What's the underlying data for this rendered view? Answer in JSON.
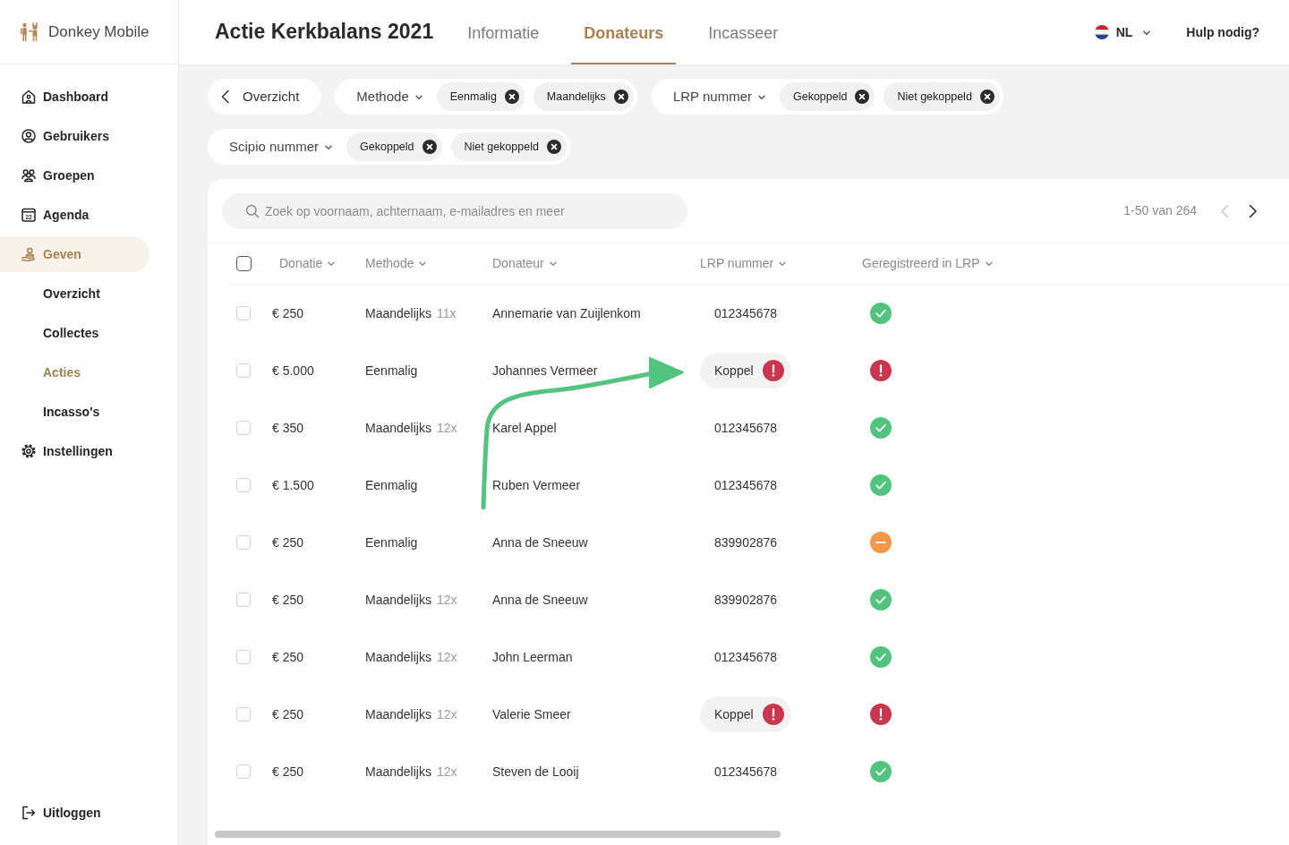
{
  "sidebar": {
    "brand": "Donkey Mobile",
    "items": [
      {
        "label": "Dashboard",
        "selected": false
      },
      {
        "label": "Gebruikers",
        "selected": false
      },
      {
        "label": "Groepen",
        "selected": false
      },
      {
        "label": "Agenda",
        "selected": false,
        "icon_text": "22"
      },
      {
        "label": "Geven",
        "selected": true,
        "children": [
          {
            "label": "Overzicht",
            "selected": false
          },
          {
            "label": "Collectes",
            "selected": false
          },
          {
            "label": "Acties",
            "selected": true
          },
          {
            "label": "Incasso's",
            "selected": false
          }
        ]
      },
      {
        "label": "Instellingen",
        "selected": false
      }
    ],
    "logout": "Uitloggen"
  },
  "header": {
    "title": "Actie Kerkbalans 2021",
    "tabs": [
      {
        "label": "Informatie",
        "selected": false
      },
      {
        "label": "Donateurs",
        "selected": true
      },
      {
        "label": "Incasseer",
        "selected": false
      }
    ],
    "language": "NL",
    "help": "Hulp nodig?"
  },
  "filters": {
    "back": "Overzicht",
    "groups": [
      {
        "label": "Methode",
        "chips": [
          "Eenmalig",
          "Maandelijks"
        ]
      },
      {
        "label": "LRP nummer",
        "chips": [
          "Gekoppeld",
          "Niet gekoppeld"
        ]
      },
      {
        "label": "Scipio nummer",
        "chips": [
          "Gekoppeld",
          "Niet gekoppeld"
        ]
      }
    ]
  },
  "table": {
    "search": {
      "placeholder": "Zoek op voornaam, achternaam, e-mailadres en meer"
    },
    "pagination": {
      "range": "1-50 van 264",
      "prev_disabled": true,
      "next_disabled": false
    },
    "select_all": false,
    "columns": [
      "Donatie",
      "Methode",
      "Donateur",
      "LRP nummer",
      "Geregistreerd in LRP"
    ],
    "rows": [
      {
        "selected": false,
        "donation": "€ 250",
        "method": "Maandelijks",
        "installments": "11x",
        "donor": "Annemarie van Zuijlenkom",
        "lrp": {
          "kind": "number",
          "text": "012345678"
        },
        "registered": true,
        "pending": false
      },
      {
        "selected": false,
        "donation": "€ 5.000",
        "method": "Eenmalig",
        "donor": "Johannes Vermeer",
        "lrp": {
          "kind": "button",
          "text": "Koppel"
        },
        "registered": false,
        "pending": false
      },
      {
        "selected": false,
        "donation": "€ 350",
        "method": "Maandelijks",
        "installments": "12x",
        "donor": "Karel Appel",
        "lrp": {
          "kind": "number",
          "text": "012345678"
        },
        "registered": true,
        "pending": false
      },
      {
        "selected": false,
        "donation": "€ 1.500",
        "method": "Eenmalig",
        "donor": "Ruben Vermeer",
        "lrp": {
          "kind": "number",
          "text": "012345678"
        },
        "registered": true,
        "pending": false
      },
      {
        "selected": false,
        "donation": "€ 250",
        "method": "Eenmalig",
        "donor": "Anna de Sneeuw",
        "lrp": {
          "kind": "number",
          "text": "839902876"
        },
        "registered": false,
        "pending": true
      },
      {
        "selected": false,
        "donation": "€ 250",
        "method": "Maandelijks",
        "installments": "12x",
        "donor": "Anna de Sneeuw",
        "lrp": {
          "kind": "number",
          "text": "839902876"
        },
        "registered": true,
        "pending": false
      },
      {
        "selected": false,
        "donation": "€ 250",
        "method": "Maandelijks",
        "installments": "12x",
        "donor": "John Leerman",
        "lrp": {
          "kind": "number",
          "text": "012345678"
        },
        "registered": true,
        "pending": false
      },
      {
        "selected": false,
        "donation": "€ 250",
        "method": "Maandelijks",
        "installments": "12x",
        "donor": "Valerie Smeer",
        "lrp": {
          "kind": "button",
          "text": "Koppel"
        },
        "registered": false,
        "pending": false
      },
      {
        "selected": false,
        "donation": "€ 250",
        "method": "Maandelijks",
        "installments": "12x",
        "donor": "Steven de Looij",
        "lrp": {
          "kind": "number",
          "text": "012345678"
        },
        "registered": true,
        "pending": false
      }
    ]
  },
  "highlight_arrow": true
}
